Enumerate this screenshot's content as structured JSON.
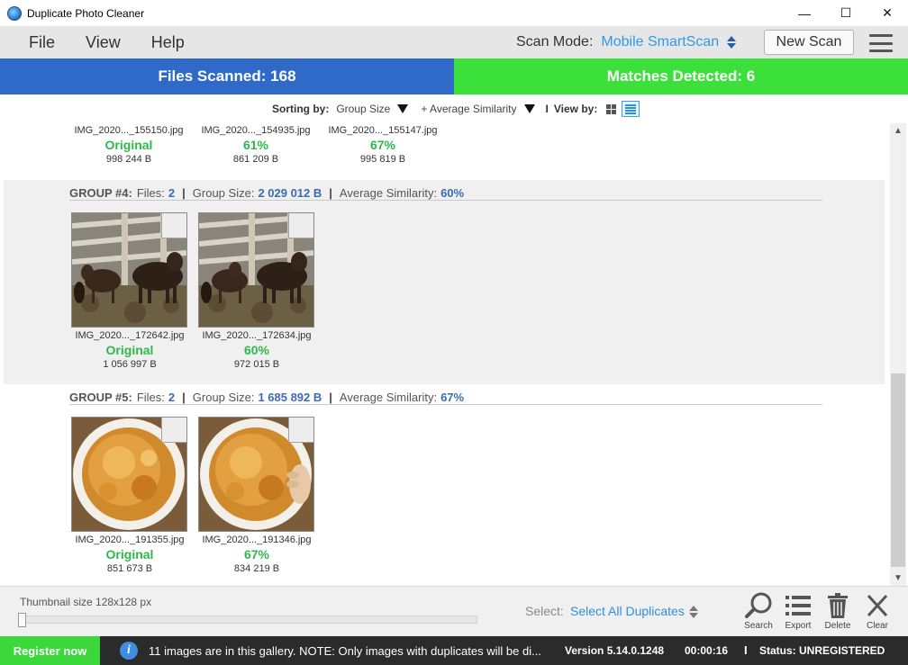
{
  "window": {
    "title": "Duplicate Photo Cleaner",
    "minimize": "—",
    "maximize": "☐",
    "close": "✕"
  },
  "menu": {
    "file": "File",
    "view": "View",
    "help": "Help"
  },
  "scan_mode": {
    "label": "Scan Mode:",
    "value": "Mobile SmartScan",
    "new_scan": "New Scan"
  },
  "stats": {
    "files_scanned": "Files Scanned: 168",
    "matches_detected": "Matches Detected: 6"
  },
  "sorting": {
    "label": "Sorting by:",
    "primary": "Group Size",
    "secondary": "+ Average Similarity",
    "separator": "I",
    "view_by": "View by:"
  },
  "group_top": {
    "items": [
      {
        "filename": "IMG_2020..._155150.jpg",
        "status": "Original",
        "size": "998 244 B"
      },
      {
        "filename": "IMG_2020..._154935.jpg",
        "status": "61%",
        "size": "861 209 B"
      },
      {
        "filename": "IMG_2020..._155147.jpg",
        "status": "67%",
        "size": "995 819 B"
      }
    ]
  },
  "group4": {
    "title": "GROUP #4:",
    "files_label": "Files:",
    "files": "2",
    "size_label": "Group Size:",
    "size": "2 029 012 B",
    "similarity_label": "Average Similarity:",
    "similarity": "60%",
    "items": [
      {
        "filename": "IMG_2020..._172642.jpg",
        "status": "Original",
        "size": "1 056 997 B"
      },
      {
        "filename": "IMG_2020..._172634.jpg",
        "status": "60%",
        "size": "972 015 B"
      }
    ]
  },
  "group5": {
    "title": "GROUP #5:",
    "files_label": "Files:",
    "files": "2",
    "size_label": "Group Size:",
    "size": "1 685 892 B",
    "similarity_label": "Average Similarity:",
    "similarity": "67%",
    "items": [
      {
        "filename": "IMG_2020..._191355.jpg",
        "status": "Original",
        "size": "851 673 B"
      },
      {
        "filename": "IMG_2020..._191346.jpg",
        "status": "67%",
        "size": "834 219 B"
      }
    ]
  },
  "separator_bar": "|",
  "toolbar": {
    "thumbnail_size": "Thumbnail size 128x128 px",
    "select_label": "Select:",
    "select_value": "Select All Duplicates",
    "search": "Search",
    "export": "Export",
    "delete": "Delete",
    "clear": "Clear"
  },
  "statusbar": {
    "register": "Register now",
    "info": "i",
    "message": "11 images are in this gallery. NOTE: Only images with duplicates will be di...",
    "version": "Version 5.14.0.1248",
    "time": "00:00:16",
    "separator": "I",
    "status": "Status: UNREGISTERED"
  },
  "colors": {
    "accent_blue": "#2f6ac9",
    "accent_green": "#3be03b",
    "link_blue": "#2e9be6",
    "status_green": "#2eb84a"
  }
}
